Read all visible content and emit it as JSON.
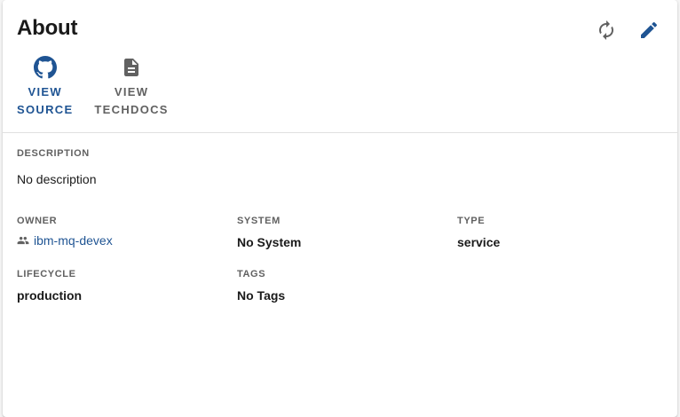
{
  "card": {
    "title": "About",
    "actions": {
      "refresh_icon": "refresh-icon",
      "edit_icon": "edit-icon"
    },
    "links": [
      {
        "icon": "github-icon",
        "line1": "VIEW",
        "line2": "SOURCE"
      },
      {
        "icon": "document-icon",
        "line1": "VIEW",
        "line2": "TECHDOCS"
      }
    ]
  },
  "fields": {
    "description": {
      "label": "DESCRIPTION",
      "value": "No description"
    },
    "owner": {
      "label": "OWNER",
      "value": "ibm-mq-devex",
      "icon": "group-icon"
    },
    "system": {
      "label": "SYSTEM",
      "value": "No System"
    },
    "type": {
      "label": "TYPE",
      "value": "service"
    },
    "lifecycle": {
      "label": "LIFECYCLE",
      "value": "production"
    },
    "tags": {
      "label": "TAGS",
      "value": "No Tags"
    }
  },
  "colors": {
    "primary": "#1f5493",
    "icon_gray": "#616161",
    "text": "#1a1a1a"
  }
}
